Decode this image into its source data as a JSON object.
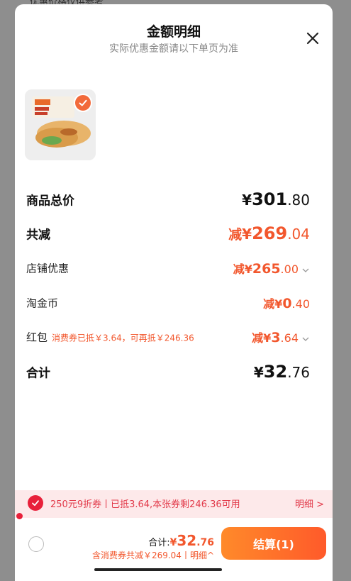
{
  "backdrop": {
    "peek_text": "优惠价格仅供参考"
  },
  "header": {
    "title": "金额明细",
    "subtitle": "实际优惠金额请以下单页为准"
  },
  "icons": {
    "close": "close-icon",
    "check": "check-icon",
    "chevron": "chevron-down-icon"
  },
  "colors": {
    "accent": "#f2572d",
    "coupon_red": "#e8203a",
    "coupon_bg": "#fde9ea"
  },
  "rows": {
    "total_price": {
      "label": "商品总价",
      "prefix": "",
      "symbol": "¥",
      "int": "301",
      "dec": ".80"
    },
    "total_discount": {
      "label": "共减",
      "prefix": "减",
      "symbol": "¥",
      "int": "269",
      "dec": ".04"
    },
    "shop_discount": {
      "label": "店铺优惠",
      "prefix": "减",
      "symbol": "¥",
      "int": "265",
      "dec": ".00"
    },
    "taojinbi": {
      "label": "淘金币",
      "prefix": "减",
      "symbol": "¥",
      "int": "0",
      "dec": ".40"
    },
    "red_packet": {
      "label": "红包",
      "note": "消费券已抵￥3.64，可再抵￥246.36",
      "prefix": "减",
      "symbol": "¥",
      "int": "3",
      "dec": ".64"
    },
    "subtotal": {
      "label": "合计",
      "symbol": "¥",
      "int": "32",
      "dec": ".76"
    }
  },
  "coupon": {
    "text": "250元9折券丨已抵3.64,本张券剩246.36可用",
    "detail_label": "明细 >"
  },
  "footer": {
    "total_label": "合计:",
    "symbol": "¥",
    "int": "32",
    "dec": ".76",
    "saving_text": "含消费券共减￥269.04丨明细^",
    "checkout_label": "结算(1)"
  }
}
